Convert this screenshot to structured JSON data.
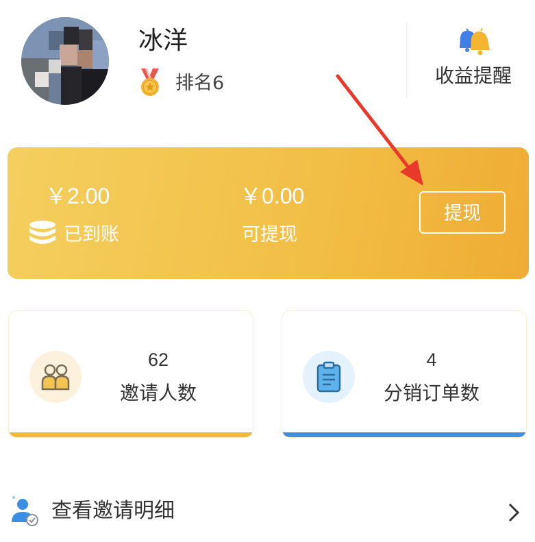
{
  "profile": {
    "name": "冰洋",
    "rank_label": "排名6"
  },
  "header": {
    "reminder_label": "收益提醒"
  },
  "earnings": {
    "received_amount": "￥2.00",
    "received_label": "已到账",
    "withdrawable_amount": "￥0.00",
    "withdrawable_label": "可提现",
    "withdraw_button": "提现"
  },
  "stats": [
    {
      "value": "62",
      "label": "邀请人数",
      "accent": "#f0b93a"
    },
    {
      "value": "4",
      "label": "分销订单数",
      "accent": "#3d8fe0"
    }
  ],
  "invite_detail": {
    "label": "查看邀请明细"
  },
  "colors": {
    "card_gold": "#f2be45",
    "annotation_arrow": "#e8392b"
  },
  "icons": {
    "reminder": "bell-icon",
    "rank": "medal-icon",
    "received": "coins-icon",
    "invites": "people-icon",
    "orders": "clipboard-icon",
    "invite_detail": "user-check-icon",
    "row_arrow": "chevron-right-icon"
  }
}
